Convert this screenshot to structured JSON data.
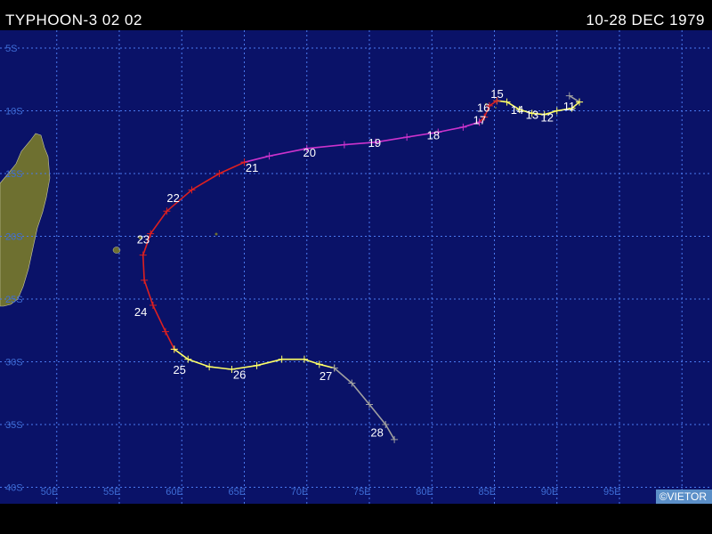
{
  "header": {
    "title": "TYPHOON-3 02 02",
    "date_range": "10-28 DEC 1979"
  },
  "credit": "©VIETOR",
  "colors": {
    "ocean": "#0a1268",
    "land": "#6e7030",
    "grid": "#4a7af0",
    "track_depression": "#a0a0a0",
    "track_storm": "#ffff66",
    "track_cyclone": "#dd2020",
    "track_intense": "#cc33cc"
  },
  "grid": {
    "lon_labels": [
      "50E",
      "55E",
      "60E",
      "65E",
      "70E",
      "75E",
      "80E",
      "85E",
      "90E",
      "95E"
    ],
    "lat_labels": [
      "5S",
      "10S",
      "15S",
      "20S",
      "25S",
      "30S",
      "35S",
      "40S"
    ]
  },
  "track": {
    "day_labels": [
      {
        "label": "11",
        "lon": 91.0,
        "lat": -9.6
      },
      {
        "label": "12",
        "lon": 89.2,
        "lat": -10.5
      },
      {
        "label": "13",
        "lon": 88.0,
        "lat": -10.3
      },
      {
        "label": "14",
        "lon": 86.8,
        "lat": -9.9
      },
      {
        "label": "15",
        "lon": 85.2,
        "lat": -8.6
      },
      {
        "label": "16",
        "lon": 84.1,
        "lat": -9.7
      },
      {
        "label": "17",
        "lon": 83.8,
        "lat": -10.7
      },
      {
        "label": "18",
        "lon": 80.1,
        "lat": -11.9
      },
      {
        "label": "19",
        "lon": 75.4,
        "lat": -12.5
      },
      {
        "label": "20",
        "lon": 70.2,
        "lat": -13.3
      },
      {
        "label": "21",
        "lon": 65.6,
        "lat": -14.5
      },
      {
        "label": "22",
        "lon": 59.3,
        "lat": -16.9
      },
      {
        "label": "23",
        "lon": 56.9,
        "lat": -20.2
      },
      {
        "label": "24",
        "lon": 56.7,
        "lat": -26.0
      },
      {
        "label": "25",
        "lon": 59.8,
        "lat": -30.6
      },
      {
        "label": "26",
        "lon": 64.6,
        "lat": -31.0
      },
      {
        "label": "27",
        "lon": 71.5,
        "lat": -31.1
      },
      {
        "label": "28",
        "lon": 75.6,
        "lat": -35.6
      }
    ],
    "segments": [
      {
        "category": "depression",
        "points": [
          [
            91.8,
            -9.3
          ],
          [
            91.0,
            -8.8
          ]
        ]
      },
      {
        "category": "storm",
        "points": [
          [
            91.8,
            -9.3
          ],
          [
            91.2,
            -9.8
          ],
          [
            90.0,
            -10.0
          ],
          [
            89.0,
            -10.3
          ],
          [
            88.0,
            -10.2
          ],
          [
            87.0,
            -9.9
          ],
          [
            86.0,
            -9.3
          ],
          [
            85.2,
            -9.2
          ]
        ]
      },
      {
        "category": "cyclone",
        "points": [
          [
            85.2,
            -9.2
          ],
          [
            84.6,
            -9.6
          ],
          [
            84.2,
            -10.5
          ],
          [
            83.8,
            -10.9
          ]
        ]
      },
      {
        "category": "intense",
        "points": [
          [
            83.8,
            -10.9
          ],
          [
            82.5,
            -11.3
          ],
          [
            80.5,
            -11.7
          ],
          [
            78.0,
            -12.1
          ],
          [
            75.5,
            -12.5
          ],
          [
            73.0,
            -12.7
          ],
          [
            70.0,
            -13.0
          ],
          [
            67.0,
            -13.6
          ],
          [
            65.0,
            -14.1
          ]
        ]
      },
      {
        "category": "cyclone",
        "points": [
          [
            65.0,
            -14.1
          ],
          [
            63.0,
            -15.0
          ],
          [
            60.8,
            -16.3
          ],
          [
            58.8,
            -18.0
          ],
          [
            57.5,
            -19.8
          ],
          [
            56.9,
            -21.5
          ],
          [
            57.0,
            -23.5
          ],
          [
            57.7,
            -25.5
          ],
          [
            58.7,
            -27.6
          ],
          [
            59.4,
            -29.0
          ]
        ]
      },
      {
        "category": "storm",
        "points": [
          [
            59.4,
            -29.0
          ],
          [
            60.5,
            -29.8
          ],
          [
            62.2,
            -30.4
          ],
          [
            64.0,
            -30.6
          ],
          [
            66.0,
            -30.3
          ],
          [
            68.0,
            -29.8
          ],
          [
            69.8,
            -29.8
          ],
          [
            71.0,
            -30.2
          ],
          [
            72.2,
            -30.5
          ]
        ]
      },
      {
        "category": "depression",
        "points": [
          [
            72.2,
            -30.5
          ],
          [
            73.6,
            -31.7
          ],
          [
            75.0,
            -33.4
          ],
          [
            76.3,
            -35.0
          ],
          [
            77.0,
            -36.2
          ]
        ]
      }
    ]
  }
}
